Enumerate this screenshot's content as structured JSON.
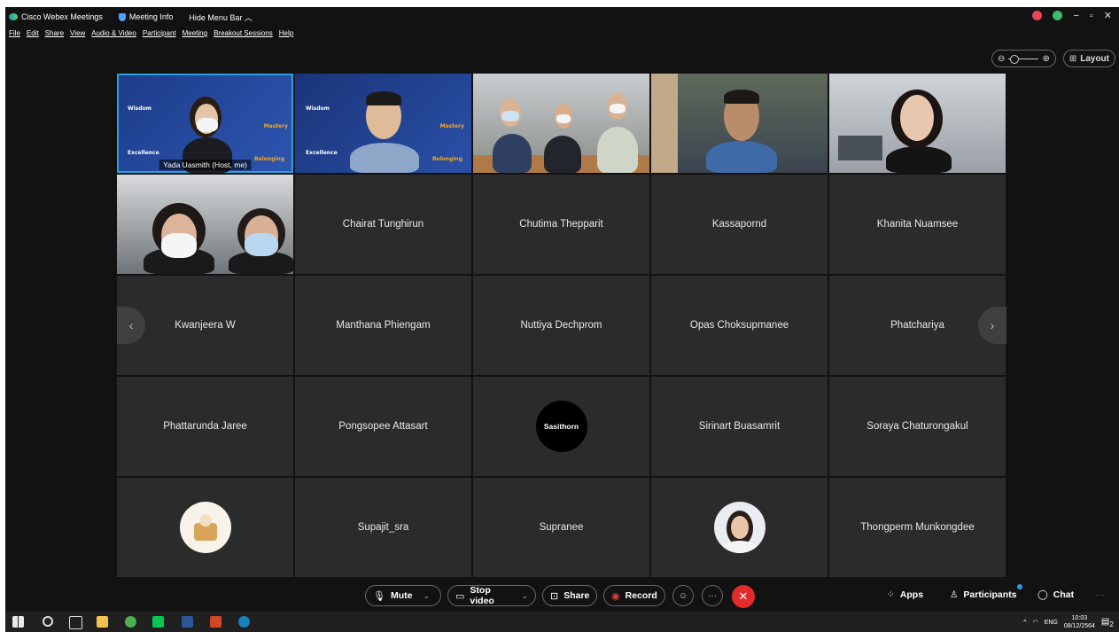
{
  "titlebar": {
    "app_name": "Cisco Webex Meetings",
    "meeting_info": "Meeting Info",
    "hide_menu_bar": "Hide Menu Bar ︿"
  },
  "window_controls": {
    "minimize": "−",
    "maximize": "▫",
    "close": "✕"
  },
  "menu": [
    "File",
    "Edit",
    "Share",
    "View",
    "Audio & Video",
    "Participant",
    "Meeting",
    "Breakout Sessions",
    "Help"
  ],
  "layout_label": "Layout",
  "participants": [
    {
      "name": "Yada Uasmith  (Host, me)",
      "type": "video"
    },
    {
      "name": "",
      "type": "video"
    },
    {
      "name": "",
      "type": "video"
    },
    {
      "name": "",
      "type": "video"
    },
    {
      "name": "",
      "type": "video"
    },
    {
      "name": "",
      "type": "video"
    },
    {
      "name": "Chairat Tunghirun",
      "type": "name"
    },
    {
      "name": "Chutima Thepparit",
      "type": "name"
    },
    {
      "name": "Kassapornd",
      "type": "name"
    },
    {
      "name": "Khanita Nuamsee",
      "type": "name"
    },
    {
      "name": "Kwanjeera W",
      "type": "name"
    },
    {
      "name": "Manthana Phiengam",
      "type": "name"
    },
    {
      "name": "Nuttiya Dechprom",
      "type": "name"
    },
    {
      "name": "Opas Choksupmanee",
      "type": "name"
    },
    {
      "name": "Phatchariya",
      "type": "name"
    },
    {
      "name": "Phattarunda Jaree",
      "type": "name"
    },
    {
      "name": "Pongsopee Attasart",
      "type": "name"
    },
    {
      "name": "Sasithorn",
      "type": "avatar-text"
    },
    {
      "name": "Sirinart Buasamrit",
      "type": "name"
    },
    {
      "name": "Soraya Chaturongakul",
      "type": "name"
    },
    {
      "name": "",
      "type": "avatar-image"
    },
    {
      "name": "Supajit_sra",
      "type": "name"
    },
    {
      "name": "Supranee",
      "type": "name"
    },
    {
      "name": "",
      "type": "avatar-image"
    },
    {
      "name": "Thongperm Munkongdee",
      "type": "name"
    }
  ],
  "branding": {
    "wisdom": "Wisdom",
    "mastery": "Mastery",
    "excellence": "Excellence",
    "belonging": "Belonging"
  },
  "controls": {
    "mute": "Mute",
    "stop_video": "Stop video",
    "share": "Share",
    "record": "Record",
    "more": "···",
    "apps": "Apps",
    "participants": "Participants",
    "chat": "Chat"
  },
  "taskbar": {
    "language": "ENG",
    "time": "10:03",
    "date": "08/12/2564",
    "notification_count": "2"
  },
  "colors": {
    "background": "#121212",
    "tile": "#2b2b2b",
    "active_border": "#2aa0e0",
    "end_call": "#e22b2b",
    "record": "#e24040"
  }
}
